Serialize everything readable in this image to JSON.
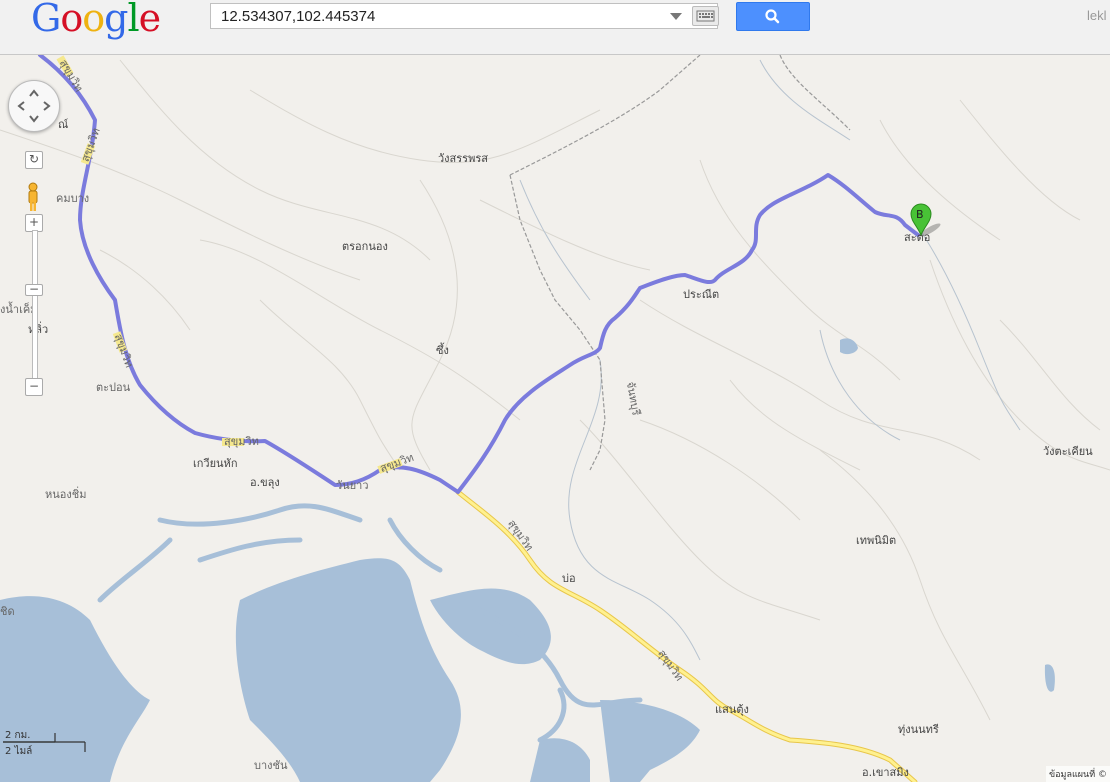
{
  "header": {
    "logo_text": "Google",
    "search_value": "12.534307,102.445374",
    "user_text": "lekl"
  },
  "map": {
    "marker_label": "B",
    "places": [
      "วังสรรพรส",
      "ตรอกนอง",
      "ซึ้ง",
      "ประณีต",
      "สะตอ",
      "คมบาง",
      "ตะปอน",
      "เกวียนหัก",
      "อ.ขลุง",
      "วันยาว",
      "หนองชิ่ม",
      "บ่อ",
      "แสนตุ้ง",
      "ทุ่งนนทรี",
      "อ.เขาสมิง",
      "เทพนิมิต",
      "วังตะเคียน",
      "บางชัน",
      "หลิ่ว",
      "ณ์",
      "งน้ำเค็ม",
      "ชิด"
    ],
    "road_labels": [
      "สุขุมวิท",
      "สุขุมวิท",
      "สุขุมวิท",
      "สุขุมวิท",
      "สุขุมวิท",
      "สุขุมวิท",
      "สุขุมวิท"
    ],
    "border_label": "จันทบุรี",
    "scale_km": "2 กม.",
    "scale_mi": "2 ไมล์",
    "map_data": "ข้อมูลแผนที่ ©"
  },
  "colors": {
    "route": "#7b7bdd",
    "land": "#f2f0ec",
    "water": "#a7bfd8",
    "highway": "#ffec8b",
    "search_button": "#4d90fe",
    "marker": "#48c236"
  }
}
